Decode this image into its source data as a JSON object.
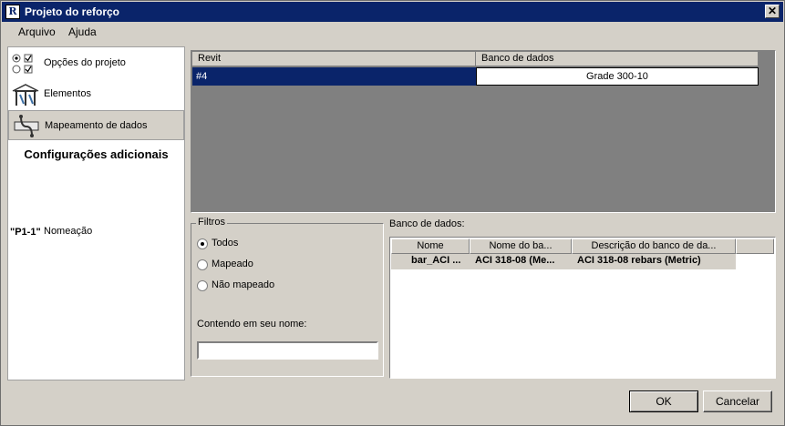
{
  "window": {
    "title": "Projeto do reforço",
    "app_icon_glyph": "R",
    "close_glyph": "✕"
  },
  "menu": {
    "items": [
      "Arquivo",
      "Ajuda"
    ]
  },
  "nav": {
    "items": [
      {
        "label": "Opções do projeto",
        "icon": "options-icon"
      },
      {
        "label": "Elementos",
        "icon": "frame-icon"
      },
      {
        "label": "Mapeamento de dados",
        "icon": "mapping-icon",
        "selected": true
      }
    ],
    "section_header": "Configurações adicionais",
    "naming": {
      "icon_text": "\"P1-1\"",
      "label": "Nomeação"
    }
  },
  "grid": {
    "columns": [
      "Revit",
      "Banco de dados"
    ],
    "rows": [
      {
        "revit": "#4",
        "database": "Grade 300-10"
      }
    ]
  },
  "filters": {
    "legend": "Filtros",
    "options": [
      "Todos",
      "Mapeado",
      "Não mapeado"
    ],
    "selected": "Todos",
    "contains_label": "Contendo em seu nome:",
    "contains_value": ""
  },
  "database": {
    "label": "Banco de dados:",
    "columns": [
      "Nome",
      "Nome do ba...",
      "Descrição do banco de da..."
    ],
    "rows": [
      {
        "name": "bar_ACI ...",
        "db_name": "ACI 318-08 (Me...",
        "description": "ACI 318-08 rebars (Metric)"
      }
    ]
  },
  "buttons": {
    "ok": "OK",
    "cancel": "Cancelar"
  },
  "colors": {
    "title_bg": "#0a246a",
    "face": "#d4d0c8",
    "selection": "#0a246a",
    "grid_bg": "#808080"
  }
}
